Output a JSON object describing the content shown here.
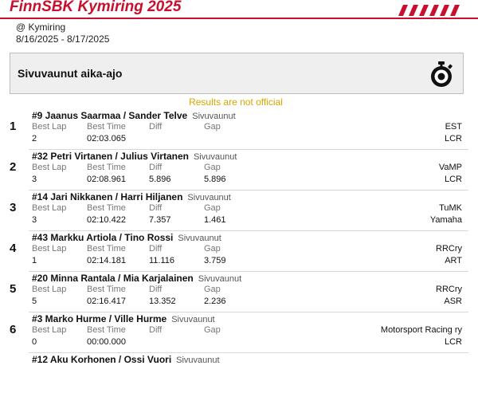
{
  "header": {
    "title": "FinnSBK Kymiring 2025",
    "venue": "@ Kymiring",
    "dates": "8/16/2025 - 8/17/2025",
    "accent_color": "#c8102e"
  },
  "session": {
    "title": "Sivuvaunut aika-ajo",
    "icon": "stopwatch-icon",
    "notice": "Results are not official",
    "notice_color": "#d6a500"
  },
  "columns": {
    "best_lap": "Best Lap",
    "best_time": "Best Time",
    "diff": "Diff",
    "gap": "Gap"
  },
  "results": [
    {
      "pos": "1",
      "names": "#9 Jaanus Saarmaa / Sander Telve",
      "class": "Sivuvaunut",
      "best_lap": "2",
      "best_time": "02:03.065",
      "diff": "",
      "gap": "",
      "team": "EST",
      "bike": "LCR"
    },
    {
      "pos": "2",
      "names": "#32 Petri Virtanen / Julius Virtanen",
      "class": "Sivuvaunut",
      "best_lap": "3",
      "best_time": "02:08.961",
      "diff": "5.896",
      "gap": "5.896",
      "team": "VaMP",
      "bike": "LCR"
    },
    {
      "pos": "3",
      "names": "#14 Jari Nikkanen / Harri Hiljanen",
      "class": "Sivuvaunut",
      "best_lap": "3",
      "best_time": "02:10.422",
      "diff": "7.357",
      "gap": "1.461",
      "team": "TuMK",
      "bike": "Yamaha"
    },
    {
      "pos": "4",
      "names": "#43 Markku Artiola / Tino Rossi",
      "class": "Sivuvaunut",
      "best_lap": "1",
      "best_time": "02:14.181",
      "diff": "11.116",
      "gap": "3.759",
      "team": "RRCry",
      "bike": "ART"
    },
    {
      "pos": "5",
      "names": "#20 Minna Rantala / Mia Karjalainen",
      "class": "Sivuvaunut",
      "best_lap": "5",
      "best_time": "02:16.417",
      "diff": "13.352",
      "gap": "2.236",
      "team": "RRCry",
      "bike": "ASR"
    },
    {
      "pos": "6",
      "names": "#3 Marko Hurme / Ville Hurme",
      "class": "Sivuvaunut",
      "best_lap": "0",
      "best_time": "00:00.000",
      "diff": "",
      "gap": "",
      "team": "Motorsport Racing ry",
      "bike": "LCR"
    },
    {
      "pos": "",
      "names": "#12 Aku Korhonen / Ossi Vuori",
      "class": "Sivuvaunut",
      "best_lap": "",
      "best_time": "",
      "diff": "",
      "gap": "",
      "team": "",
      "bike": ""
    }
  ]
}
